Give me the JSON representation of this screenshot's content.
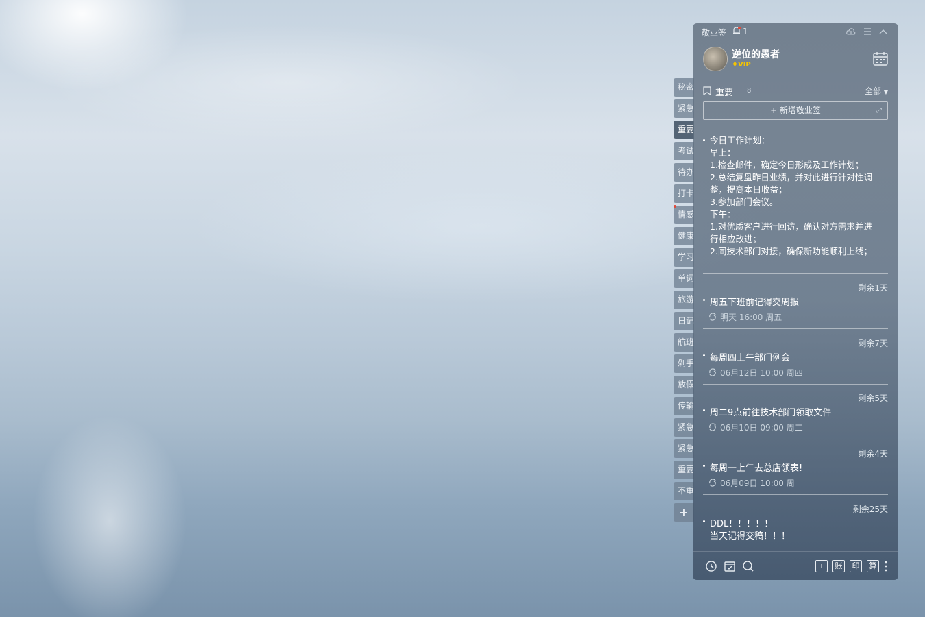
{
  "sidebar": {
    "tabs": [
      {
        "label": "秘密"
      },
      {
        "label": "紧急"
      },
      {
        "label": "重要",
        "active": true
      },
      {
        "label": "考试"
      },
      {
        "label": "待办"
      },
      {
        "label": "打卡"
      },
      {
        "label": "情感"
      },
      {
        "label": "健康"
      },
      {
        "label": "学习"
      },
      {
        "label": "单词"
      },
      {
        "label": "旅游"
      },
      {
        "label": "日记"
      },
      {
        "label": "航班"
      },
      {
        "label": "剁手"
      },
      {
        "label": "放假"
      },
      {
        "label": "传输"
      },
      {
        "label": "紧急"
      },
      {
        "label": "紧急"
      },
      {
        "label": "重要"
      },
      {
        "label": "不重"
      }
    ],
    "add_label": "+"
  },
  "titlebar": {
    "app_name": "敬业签",
    "notify_count": "1"
  },
  "user": {
    "name": "逆位的愚者",
    "badge": "VIP"
  },
  "section": {
    "title": "重要",
    "count": "8",
    "filter": "全部"
  },
  "add_note": {
    "label": "+ 新增敬业签"
  },
  "main_note": {
    "lines": [
      "今日工作计划：",
      "早上：",
      "1.检查邮件，确定今日形成及工作计划；",
      "2.总结复盘昨日业绩，并对此进行针对性调",
      "整，提高本日收益；",
      "3.参加部门会议。",
      "下午：",
      "1.对优质客户进行回访，确认对方需求并进",
      "行相应改进；",
      "2.同技术部门对接，确保新功能顺利上线；"
    ]
  },
  "notes": [
    {
      "remain": "剩余1天",
      "title": "周五下班前记得交周报",
      "time": "明天 16:00 周五"
    },
    {
      "remain": "剩余7天",
      "title": "每周四上午部门例会",
      "time": "06月12日 10:00 周四"
    },
    {
      "remain": "剩余5天",
      "title": "周二9点前往技术部门领取文件",
      "time": "06月10日 09:00 周二"
    },
    {
      "remain": "剩余4天",
      "title": "每周一上午去总店领表!",
      "time": "06月09日 10:00 周一"
    },
    {
      "remain": "剩余25天",
      "title": "DDL！！！！！",
      "title2": "当天记得交稿！！！"
    }
  ],
  "footer": {
    "btn_add": "+",
    "btn_account": "账",
    "btn_print": "印",
    "btn_calc": "算"
  }
}
